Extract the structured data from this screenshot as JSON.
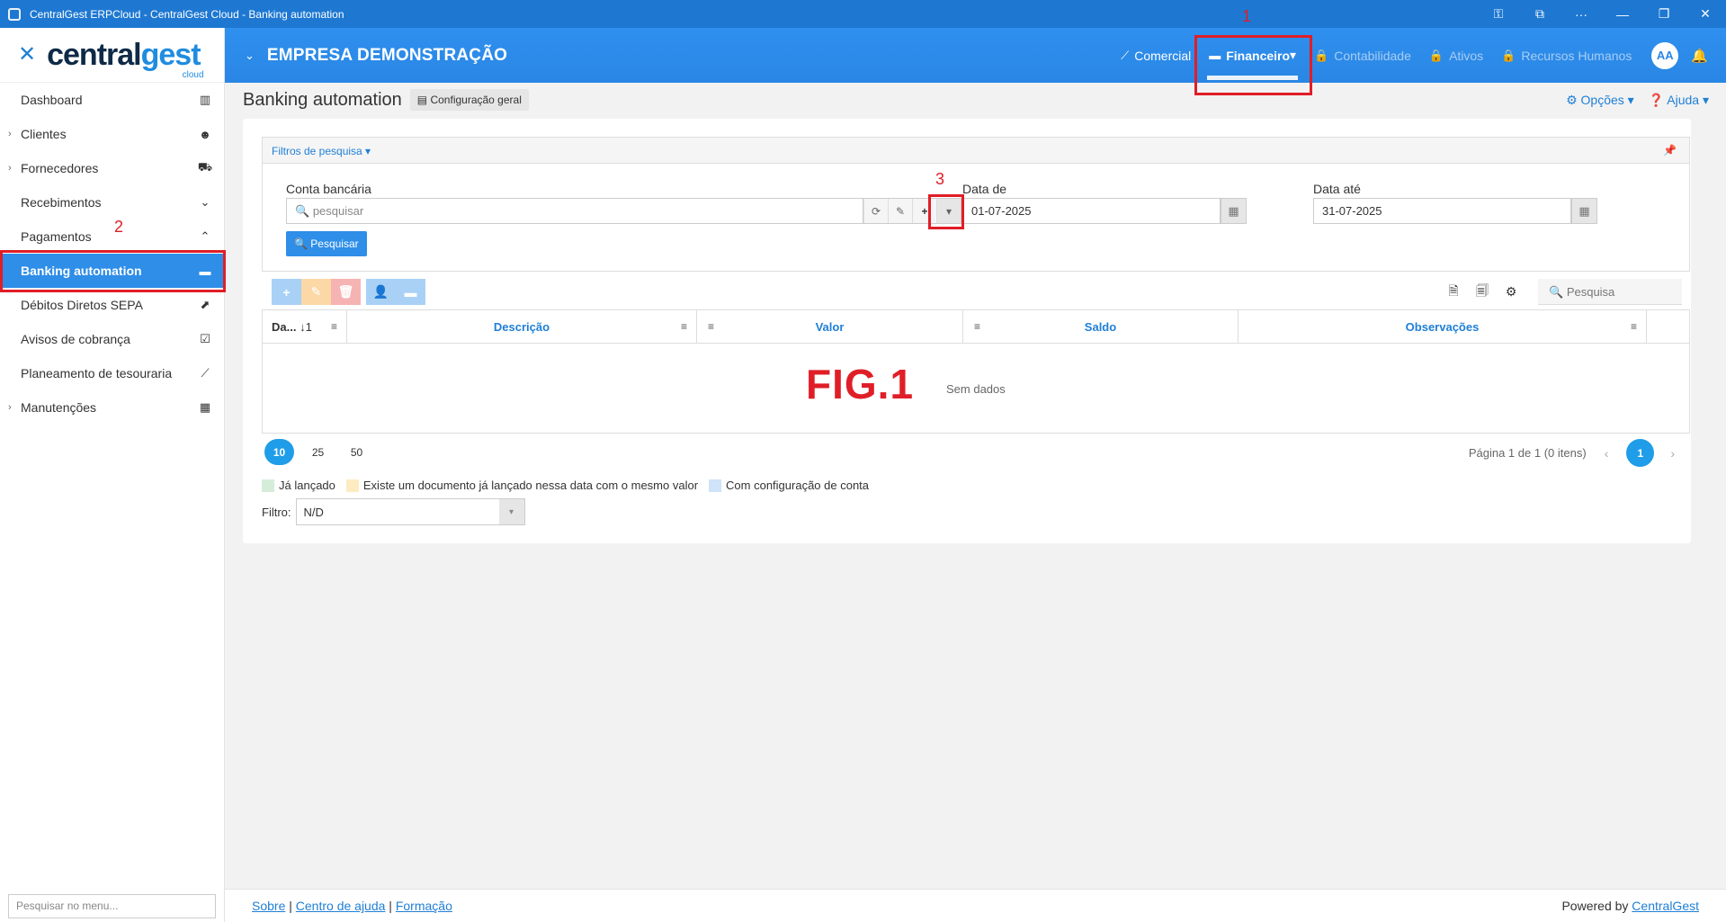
{
  "window": {
    "title": "CentralGest ERPCloud - CentralGest Cloud - Banking automation",
    "controls": [
      "⚿",
      "⧉",
      "···",
      "—",
      "❐",
      "✕"
    ]
  },
  "logo": {
    "part1": "central",
    "part2": "gest",
    "sub": "cloud"
  },
  "sidebar": {
    "items": [
      {
        "label": "Dashboard",
        "icon": "bar-chart-icon",
        "glyph": "▥",
        "expandable": false
      },
      {
        "label": "Clientes",
        "icon": "users-icon",
        "glyph": "☻",
        "expandable": true
      },
      {
        "label": "Fornecedores",
        "icon": "truck-icon",
        "glyph": "⛟",
        "expandable": true
      },
      {
        "label": "Recebimentos",
        "icon": "chevron-circle-down-icon",
        "glyph": "⌄",
        "expandable": false
      },
      {
        "label": "Pagamentos",
        "icon": "chevron-circle-up-icon",
        "glyph": "⌃",
        "expandable": false
      },
      {
        "label": "Banking automation",
        "icon": "credit-card-icon",
        "glyph": "▬",
        "expandable": false,
        "active": true
      },
      {
        "label": "Débitos Diretos SEPA",
        "icon": "external-link-icon",
        "glyph": "⬈",
        "expandable": false
      },
      {
        "label": "Avisos de cobrança",
        "icon": "calendar-check-icon",
        "glyph": "☑",
        "expandable": false
      },
      {
        "label": "Planeamento de tesouraria",
        "icon": "line-chart-icon",
        "glyph": "⟋",
        "expandable": false
      },
      {
        "label": "Manutenções",
        "icon": "table-icon",
        "glyph": "▦",
        "expandable": true
      }
    ],
    "search_placeholder": "Pesquisar no menu..."
  },
  "topbar": {
    "company": "EMPRESA DEMONSTRAÇÃO",
    "nav": [
      {
        "label": "Comercial",
        "icon": "line-chart-icon",
        "glyph": "⟋",
        "state": "enabled"
      },
      {
        "label": "Financeiro",
        "icon": "credit-card-icon",
        "glyph": "▬",
        "state": "current",
        "caret": "▾"
      },
      {
        "label": "Contabilidade",
        "icon": "lock-icon",
        "glyph": "🔒",
        "state": "disabled"
      },
      {
        "label": "Ativos",
        "icon": "lock-icon",
        "glyph": "🔒",
        "state": "disabled"
      },
      {
        "label": "Recursos Humanos",
        "icon": "lock-icon",
        "glyph": "🔒",
        "state": "disabled"
      }
    ],
    "avatar": "AA"
  },
  "page": {
    "title": "Banking automation",
    "config_button": "Configuração geral",
    "options": "Opções",
    "help": "Ajuda"
  },
  "filters": {
    "header": "Filtros de pesquisa",
    "conta_label": "Conta bancária",
    "conta_placeholder": "pesquisar",
    "data_de_label": "Data de",
    "data_de_value": "01-07-2025",
    "data_ate_label": "Data até",
    "data_ate_value": "31-07-2025",
    "search_button": "Pesquisar"
  },
  "grid": {
    "search_placeholder": "Pesquisa",
    "columns": [
      "Da...",
      "Descrição",
      "Valor",
      "Saldo",
      "Observações"
    ],
    "sort_indicator": "↓1",
    "empty_text": "Sem dados"
  },
  "pager": {
    "sizes": [
      "10",
      "25",
      "50"
    ],
    "selected_size": "10",
    "info": "Página 1 de 1 (0 itens)",
    "current_page": "1"
  },
  "legend": [
    {
      "label": "Já lançado",
      "color": "#d5ecd9"
    },
    {
      "label": "Existe um documento já lançado nessa data com o mesmo valor",
      "color": "#fdebc2"
    },
    {
      "label": "Com configuração de conta",
      "color": "#cfe3f9"
    }
  ],
  "filtro": {
    "label": "Filtro:",
    "value": "N/D"
  },
  "footer": {
    "links": [
      "Sobre",
      "Centro de ajuda",
      "Formação"
    ],
    "powered_prefix": "Powered by",
    "powered_link": "CentralGest"
  },
  "annotations": {
    "n1": "1",
    "n2": "2",
    "n3": "3",
    "fig": "FIG.1"
  }
}
